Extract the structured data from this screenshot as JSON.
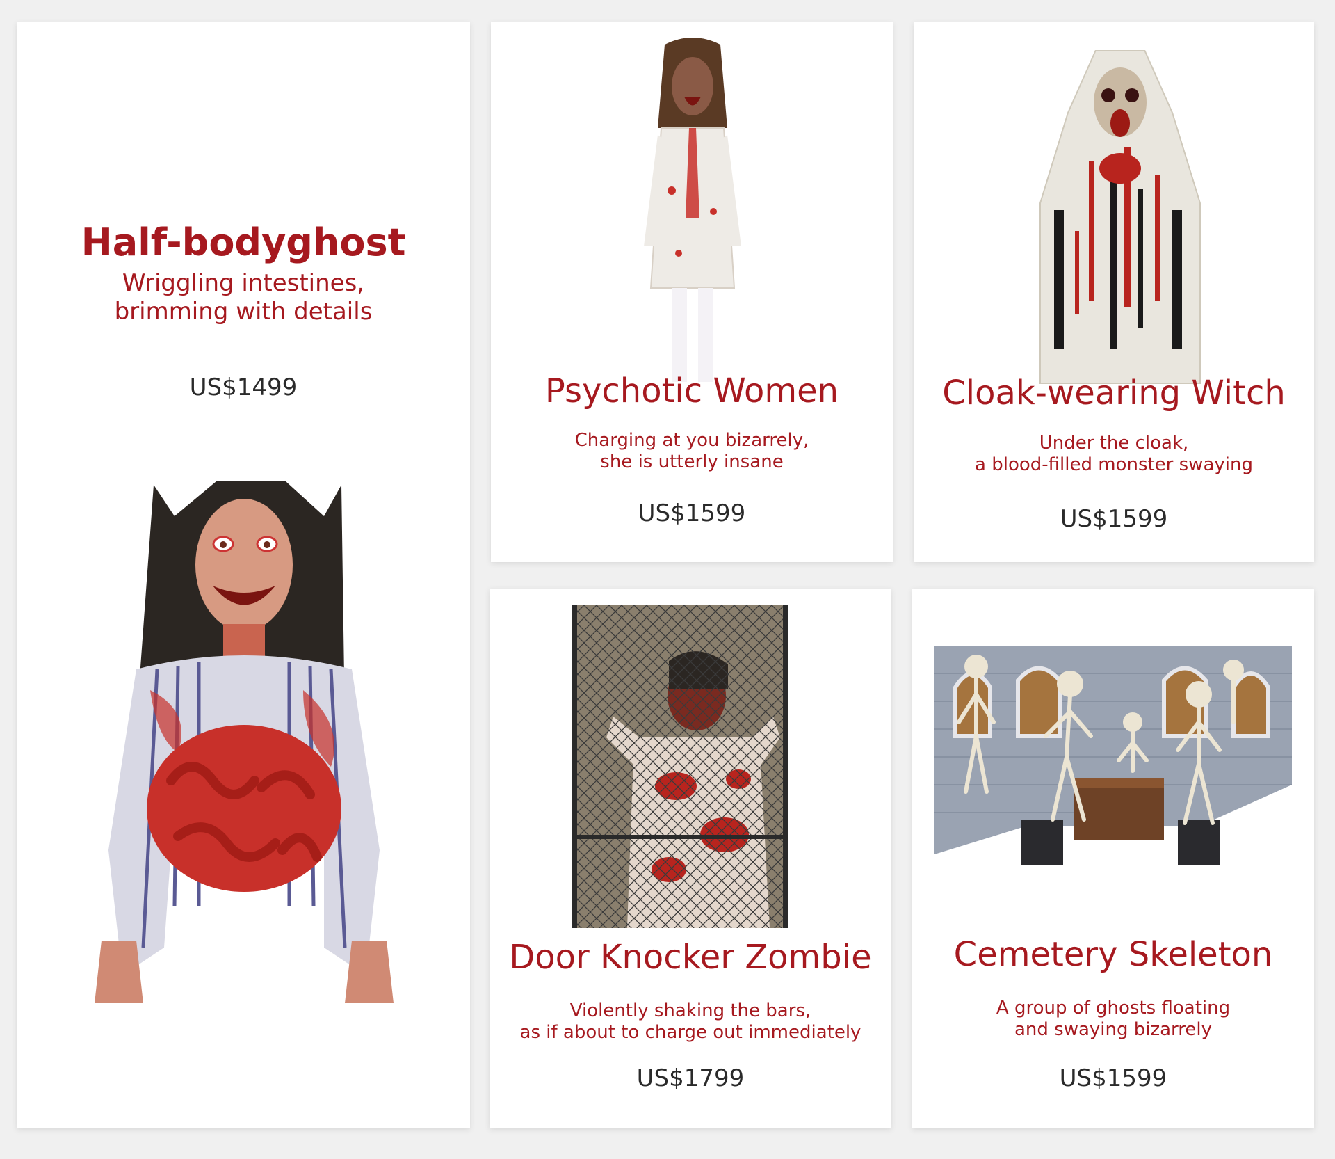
{
  "products": [
    {
      "title": "Half-bodyghost",
      "desc_line1": "Wriggling intestines,",
      "desc_line2": "brimming with details",
      "price": "US$1499"
    },
    {
      "title": "Psychotic Women",
      "desc_line1": "Charging at you bizarrely,",
      "desc_line2": "she is utterly insane",
      "price": "US$1599"
    },
    {
      "title": "Cloak-wearing Witch",
      "desc_line1": "Under the cloak,",
      "desc_line2": "a blood-filled monster swaying",
      "price": "US$1599"
    },
    {
      "title": "Door Knocker Zombie",
      "desc_line1": "Violently shaking the bars,",
      "desc_line2": "as if about to charge out immediately",
      "price": "US$1799"
    },
    {
      "title": "Cemetery Skeleton",
      "desc_line1": "A group of ghosts floating",
      "desc_line2": "and swaying bizarrely",
      "price": "US$1599"
    }
  ],
  "colors": {
    "accent": "#a6191f",
    "price_text": "#2a2a2a",
    "background": "#f0f0f0",
    "card": "#ffffff"
  }
}
